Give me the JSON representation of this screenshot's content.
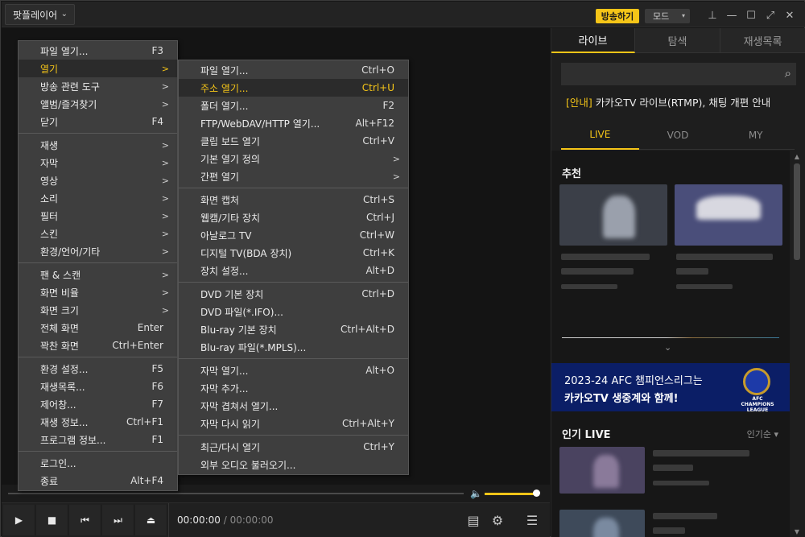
{
  "app": {
    "title": "팟플레이어",
    "title_chevron": "⌄",
    "broadcast_button": "방송하기",
    "mode_label": "모드",
    "mode_arrow": "▾",
    "window_controls": {
      "pin": "⊥",
      "minimize": "—",
      "maximize": "☐",
      "fullscreen": "⤢",
      "close": "✕"
    }
  },
  "main_menu": [
    {
      "label": "파일 열기...",
      "shortcut": "F3"
    },
    {
      "label": "열기",
      "submenu": true,
      "highlighted": true
    },
    {
      "label": "방송 관련 도구",
      "submenu": true
    },
    {
      "label": "앨범/즐겨찾기",
      "submenu": true
    },
    {
      "label": "닫기",
      "shortcut": "F4"
    },
    {
      "separator": true
    },
    {
      "label": "재생",
      "submenu": true
    },
    {
      "label": "자막",
      "submenu": true
    },
    {
      "label": "영상",
      "submenu": true
    },
    {
      "label": "소리",
      "submenu": true
    },
    {
      "label": "필터",
      "submenu": true
    },
    {
      "label": "스킨",
      "submenu": true
    },
    {
      "label": "환경/언어/기타",
      "submenu": true
    },
    {
      "separator": true
    },
    {
      "label": "팬 & 스캔",
      "submenu": true
    },
    {
      "label": "화면 비율",
      "submenu": true
    },
    {
      "label": "화면 크기",
      "submenu": true
    },
    {
      "label": "전체 화면",
      "shortcut": "Enter"
    },
    {
      "label": "꽉찬 화면",
      "shortcut": "Ctrl+Enter"
    },
    {
      "separator": true
    },
    {
      "label": "환경 설정...",
      "shortcut": "F5"
    },
    {
      "label": "재생목록...",
      "shortcut": "F6"
    },
    {
      "label": "제어창...",
      "shortcut": "F7"
    },
    {
      "label": "재생 정보...",
      "shortcut": "Ctrl+F1"
    },
    {
      "label": "프로그램 정보...",
      "shortcut": "F1"
    },
    {
      "separator": true
    },
    {
      "label": "로그인..."
    },
    {
      "label": "종료",
      "shortcut": "Alt+F4"
    }
  ],
  "sub_menu": [
    {
      "label": "파일 열기...",
      "shortcut": "Ctrl+O"
    },
    {
      "label": "주소 열기...",
      "shortcut": "Ctrl+U",
      "highlighted": true
    },
    {
      "label": "폴더 열기...",
      "shortcut": "F2"
    },
    {
      "label": "FTP/WebDAV/HTTP 열기...",
      "shortcut": "Alt+F12"
    },
    {
      "label": "클립 보드 열기",
      "shortcut": "Ctrl+V"
    },
    {
      "label": "기본 열기 정의",
      "submenu": true
    },
    {
      "label": "간편 열기",
      "submenu": true
    },
    {
      "separator": true
    },
    {
      "label": "화면 캡처",
      "shortcut": "Ctrl+S"
    },
    {
      "label": "웹캠/기타 장치",
      "shortcut": "Ctrl+J"
    },
    {
      "label": "아날로그 TV",
      "shortcut": "Ctrl+W"
    },
    {
      "label": "디지털 TV(BDA 장치)",
      "shortcut": "Ctrl+K"
    },
    {
      "label": "장치 설정...",
      "shortcut": "Alt+D"
    },
    {
      "separator": true
    },
    {
      "label": "DVD 기본 장치",
      "shortcut": "Ctrl+D"
    },
    {
      "label": "DVD 파일(*.IFO)..."
    },
    {
      "label": "Blu-ray 기본 장치",
      "shortcut": "Ctrl+Alt+D"
    },
    {
      "label": "Blu-ray 파일(*.MPLS)..."
    },
    {
      "separator": true
    },
    {
      "label": "자막 열기...",
      "shortcut": "Alt+O"
    },
    {
      "label": "자막 추가..."
    },
    {
      "label": "자막 겹쳐서 열기..."
    },
    {
      "label": "자막 다시 읽기",
      "shortcut": "Ctrl+Alt+Y"
    },
    {
      "separator": true
    },
    {
      "label": "최근/다시 열기",
      "shortcut": "Ctrl+Y"
    },
    {
      "label": "외부 오디오 불러오기..."
    }
  ],
  "submenu_arrow": ">",
  "player": {
    "current_time": "00:00:00",
    "separator": "/",
    "total_time": "00:00:00",
    "volume": 1.0,
    "progress": 0,
    "icons": {
      "play": "▶",
      "stop": "■",
      "prev": "⏮",
      "next": "⏭",
      "eject": "⏏",
      "playlist": "▤",
      "settings": "⚙",
      "menu": "☰",
      "volume": "🔈"
    }
  },
  "panel": {
    "tabs": [
      "라이브",
      "탐색",
      "재생목록"
    ],
    "active_tab": 0,
    "search_icon": "⌕",
    "notice_tag": "[안내]",
    "notice_text": " 카카오TV 라이브(RTMP), 채팅 개편 안내",
    "sub_tabs": [
      "LIVE",
      "VOD",
      "MY"
    ],
    "active_sub_tab": 0,
    "recommended_title": "추천",
    "expand_icon": "⌄",
    "banner_line1": "2023-24 AFC 챔피언스리그는",
    "banner_line2": "카카오TV 생중계와 함께!",
    "banner_logo_text": "AFC CHAMPIONS LEAGUE",
    "popular_title": "인기 LIVE",
    "sort_label": "인기순 ▾",
    "scroll_up": "▲",
    "scroll_down": "▼"
  },
  "colors": {
    "accent": "#f5c518",
    "banner_bg": "#0b1e66",
    "menu_bg": "#3e3e3e"
  }
}
